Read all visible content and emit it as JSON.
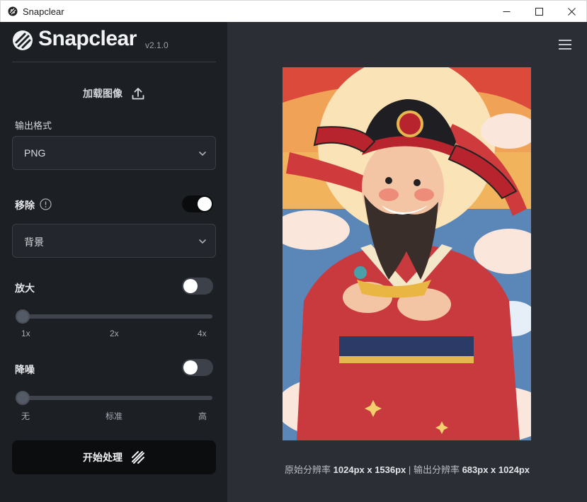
{
  "window": {
    "title": "Snapclear"
  },
  "sidebar": {
    "brand": "Snapclear",
    "version": "v2.1.0",
    "upload_label": "加载图像",
    "format": {
      "label": "输出格式",
      "value": "PNG"
    },
    "remove": {
      "label": "移除",
      "enabled": true,
      "value": "背景"
    },
    "upscale": {
      "label": "放大",
      "enabled": false,
      "level": "1x",
      "ticks": [
        "1x",
        "2x",
        "4x"
      ]
    },
    "denoise": {
      "label": "降噪",
      "enabled": false,
      "level": "无",
      "ticks": [
        "无",
        "标准",
        "高"
      ]
    },
    "start_label": "开始处理"
  },
  "main": {
    "original_label": "原始分辨率",
    "original_value": "1024px x 1536px",
    "separator": "|",
    "output_label": "输出分辨率",
    "output_value": "683px x 1024px"
  },
  "colors": {
    "sidebar_bg": "#1c1f24",
    "main_bg": "#2b2e34",
    "start_button_bg": "#0b0d0e"
  }
}
